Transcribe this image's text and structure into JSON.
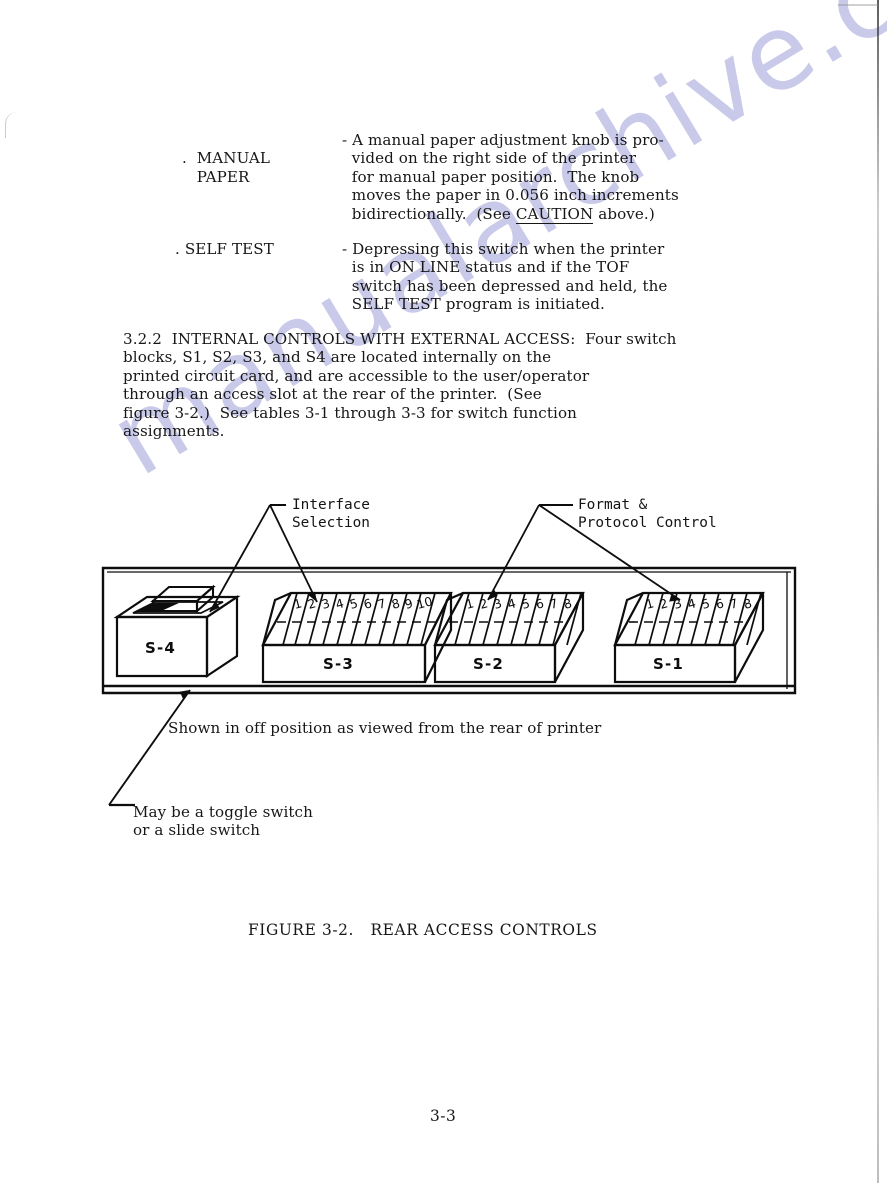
{
  "document": {
    "page_number": "3-3",
    "watermark_text": "manualarchive.com",
    "watermark_color": "#c9c9ea",
    "ink_color": "#171717"
  },
  "bullets": [
    {
      "marker": ".",
      "term_line1": "MANUAL",
      "term_line2": "PAPER",
      "dash": "-",
      "description_lines": [
        "A manual paper adjustment knob is pro-",
        "vided on the right side of the printer",
        "for manual paper position.  The knob",
        "moves the paper in 0.056 inch increments",
        "bidirectionally.  (See ",
        " above.)"
      ],
      "underlined_word": "CAUTION"
    },
    {
      "marker": ".",
      "term_line1": "SELF TEST",
      "dash": "-",
      "description_lines": [
        "Depressing this switch when the printer",
        "is in ON LINE status and if the TOF",
        "switch has been depressed and held, the",
        "SELF TEST program is initiated."
      ]
    }
  ],
  "section": {
    "number": "3.2.2",
    "heading": "INTERNAL CONTROLS WITH EXTERNAL ACCESS:",
    "lines": [
      "3.2.2  INTERNAL CONTROLS WITH EXTERNAL ACCESS:  Four switch",
      "blocks, S1, S2, S3, and S4 are located internally on the",
      "printed circuit card, and are accessible to the user/operator",
      "through an access slot at the rear of the printer.  (See",
      "figure 3-2.)  See tables 3-1 through 3-3 for switch function",
      "assignments."
    ]
  },
  "figure": {
    "title": "FIGURE 3-2.   REAR ACCESS CONTROLS",
    "caption_shown": "Shown in off position as viewed from the rear of printer",
    "note_toggle_line1": "May be a toggle switch",
    "note_toggle_line2": "or a slide switch",
    "callouts": [
      {
        "id": "interface-selection",
        "line1": "Interface",
        "line2": "Selection"
      },
      {
        "id": "format-protocol-control",
        "line1": "Format &",
        "line2": "Protocol Control"
      }
    ],
    "switch_blocks": [
      {
        "id": "s4",
        "label": "S-4",
        "type": "slide",
        "switch_count": 0,
        "switch_numbers": [],
        "callout": "interface-selection"
      },
      {
        "id": "s3",
        "label": "S-3",
        "type": "dip",
        "switch_count": 10,
        "switch_numbers": [
          "1",
          "2",
          "3",
          "4",
          "5",
          "6",
          "7",
          "8",
          "9",
          "10"
        ],
        "callout": "interface-selection"
      },
      {
        "id": "s2",
        "label": "S-2",
        "type": "dip",
        "switch_count": 8,
        "switch_numbers": [
          "1",
          "2",
          "3",
          "4",
          "5",
          "6",
          "7",
          "8"
        ],
        "callout": "format-protocol-control"
      },
      {
        "id": "s1",
        "label": "S-1",
        "type": "dip",
        "switch_count": 8,
        "switch_numbers": [
          "1",
          "2",
          "3",
          "4",
          "5",
          "6",
          "7",
          "8"
        ],
        "callout": "format-protocol-control"
      }
    ]
  }
}
